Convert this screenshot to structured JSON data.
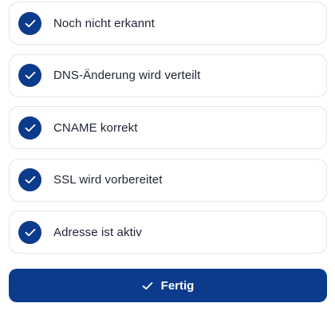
{
  "steps": [
    {
      "label": "Noch nicht erkannt",
      "icon": "check-icon",
      "status": "done"
    },
    {
      "label": "DNS-Änderung wird verteilt",
      "icon": "check-icon",
      "status": "done"
    },
    {
      "label": "CNAME korrekt",
      "icon": "check-icon",
      "status": "done"
    },
    {
      "label": "SSL wird vorbereitet",
      "icon": "check-icon",
      "status": "done"
    },
    {
      "label": "Adresse ist aktiv",
      "icon": "check-icon",
      "status": "done"
    }
  ],
  "done_button": {
    "label": "Fertig",
    "icon": "check-icon"
  },
  "colors": {
    "accent": "#0c3a8c",
    "card_border": "#e3e6ee",
    "text": "#1e2433"
  }
}
